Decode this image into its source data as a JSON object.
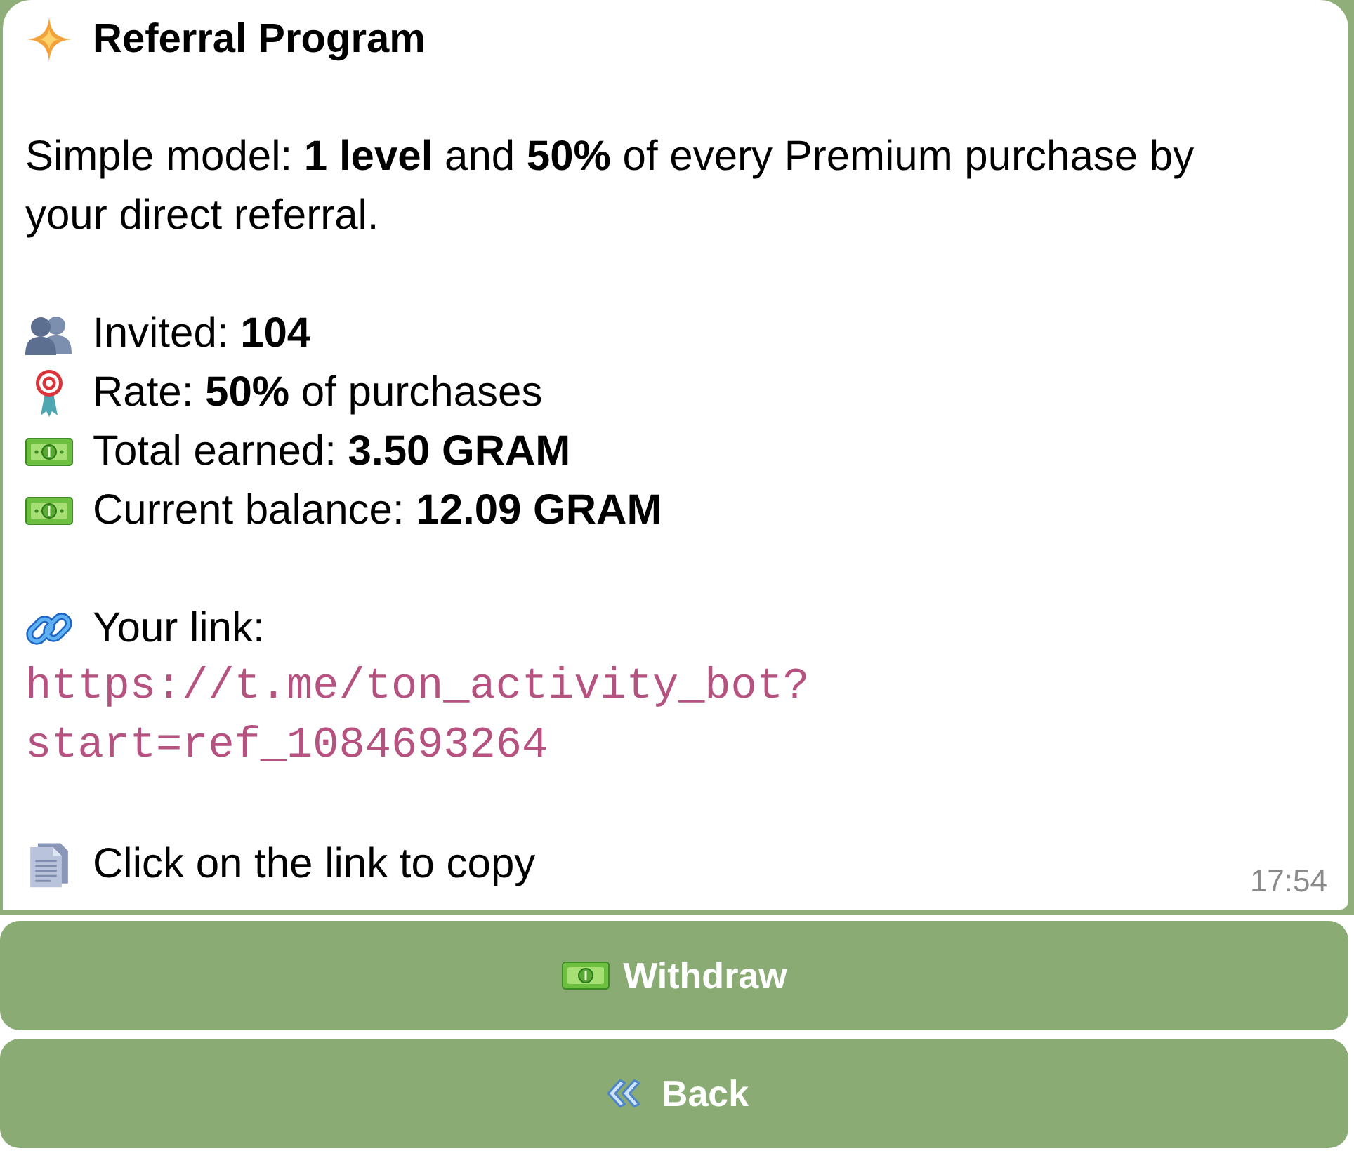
{
  "message": {
    "title": "Referral Program",
    "intro": "Simple model: **1 level** and **50%** of every Premium purchase by your direct referral.",
    "stats": [
      {
        "kind": "people",
        "text": "Invited: **104**"
      },
      {
        "kind": "target",
        "text": "Rate: **50%** of purchases"
      },
      {
        "kind": "money",
        "text": "Total earned: **3.50 GRAM**"
      },
      {
        "kind": "money",
        "text": "Current balance: **12.09 GRAM**"
      }
    ],
    "link_label": "Your link:",
    "link": "https://t.me/ton_activity_bot?start=ref_1084693264",
    "hint": "Click on the link to copy",
    "time": "17:54"
  },
  "buttons": [
    {
      "kind": "money",
      "label": "Withdraw"
    },
    {
      "kind": "back",
      "label": "Back"
    }
  ]
}
